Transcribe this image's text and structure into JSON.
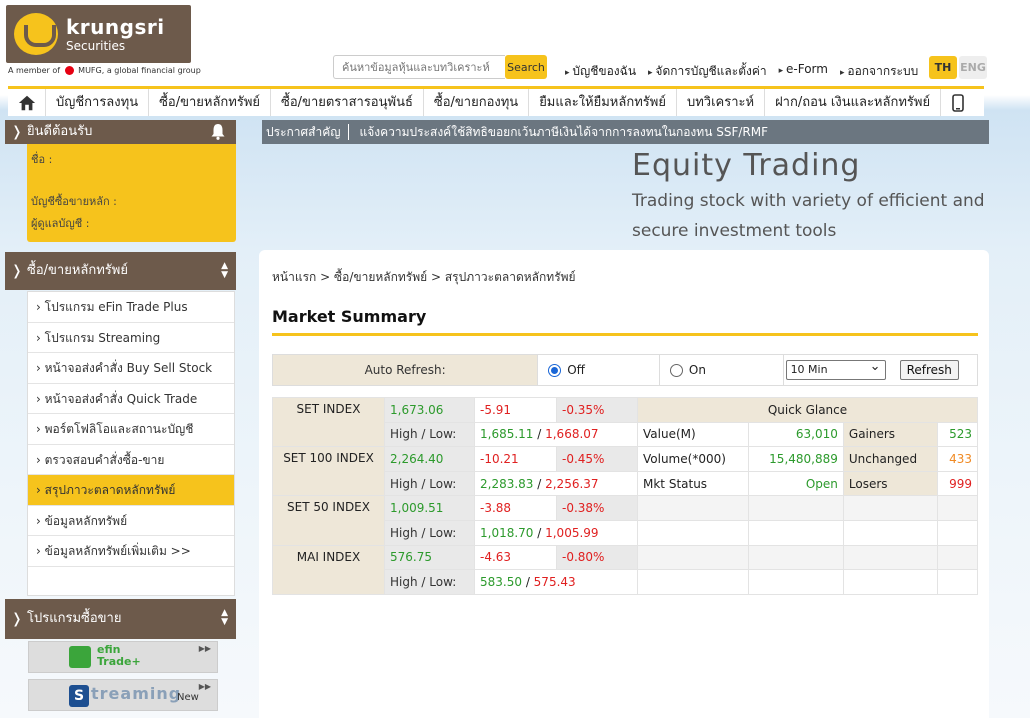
{
  "brand": {
    "name": "krungsri",
    "sub": "Securities",
    "member": "A member of",
    "member_group": "MUFG, a global financial group"
  },
  "search": {
    "placeholder": "ค้นหาข้อมูลหุ้นและบทวิเคราะห์",
    "button": "Search"
  },
  "toplinks": [
    "บัญชีของฉัน",
    "จัดการบัญชีและตั้งค่า",
    "e-Form",
    "ออกจากระบบ"
  ],
  "lang": {
    "th": "TH",
    "en": "ENG"
  },
  "nav": [
    "บัญชีการลงทุน",
    "ซื้อ/ขายหลักทรัพย์",
    "ซื้อ/ขายตราสารอนุพันธ์",
    "ซื้อ/ขายกองทุน",
    "ยืมและให้ยืมหลักทรัพย์",
    "บทวิเคราะห์",
    "ฝาก/ถอน เงินและหลักทรัพย์"
  ],
  "welcome": {
    "title": "ยินดีต้อนรับ",
    "name_label": "ชื่อ :",
    "account_label": "บัญชีซื้อขายหลัก :",
    "manager_label": "ผู้ดูแลบัญชี :"
  },
  "trade_menu": {
    "title": "ซื้อ/ขายหลักทรัพย์",
    "items": [
      "โปรแกรม eFin Trade Plus",
      "โปรแกรม Streaming",
      "หน้าจอส่งคำสั่ง Buy Sell Stock",
      "หน้าจอส่งคำสั่ง Quick Trade",
      "พอร์ตโฟลิโอและสถานะบัญชี",
      "ตรวจสอบคำสั่งซื้อ-ขาย",
      "สรุปภาวะตลาดหลักทรัพย์",
      "ข้อมูลหลักทรัพย์",
      "ข้อมูลหลักทรัพย์เพิ่มเติม >>"
    ],
    "active_index": 6
  },
  "programs": {
    "title": "โปรแกรมซื้อขาย",
    "efin_line1": "efin",
    "efin_line2": "Trade+",
    "streaming": "treaming",
    "streaming_s": "S",
    "streaming_new": "New"
  },
  "announce": {
    "label": "ประกาศสำคัญ",
    "text": "แจ้งความประสงค์ใช้สิทธิขอยกเว้นภาษีเงินได้จากการลงทนในกองทน SSF/RMF"
  },
  "banner": {
    "title": "Equity Trading",
    "subtitle": "Trading stock with variety of efficient and secure investment tools"
  },
  "breadcrumb": "หน้าแรก > ซื้อ/ขายหลักทรัพย์ > สรุปภาวะตลาดหลักทรัพย์",
  "page_title": "Market Summary",
  "refresh": {
    "label": "Auto Refresh:",
    "off": "Off",
    "on": "On",
    "selected": "off",
    "interval": "10 Min",
    "button": "Refresh"
  },
  "indices": [
    {
      "name": "SET INDEX",
      "value": "1,673.06",
      "change": "-5.91",
      "pct": "-0.35%",
      "hl_label": "High / Low:",
      "high": "1,685.11",
      "low": "1,668.07"
    },
    {
      "name": "SET 100 INDEX",
      "value": "2,264.40",
      "change": "-10.21",
      "pct": "-0.45%",
      "hl_label": "High / Low:",
      "high": "2,283.83",
      "low": "2,256.37"
    },
    {
      "name": "SET 50 INDEX",
      "value": "1,009.51",
      "change": "-3.88",
      "pct": "-0.38%",
      "hl_label": "High / Low:",
      "high": "1,018.70",
      "low": "1,005.99"
    },
    {
      "name": "MAI INDEX",
      "value": "576.75",
      "change": "-4.63",
      "pct": "-0.80%",
      "hl_label": "High / Low:",
      "high": "583.50",
      "low": "575.43"
    }
  ],
  "quick_glance": {
    "title": "Quick Glance",
    "value_label": "Value(M)",
    "value": "63,010",
    "volume_label": "Volume(*000)",
    "volume": "15,480,889",
    "status_label": "Mkt Status",
    "status": "Open",
    "gainers_label": "Gainers",
    "gainers": "523",
    "unchanged_label": "Unchanged",
    "unchanged": "433",
    "losers_label": "Losers",
    "losers": "999"
  },
  "colors": {
    "accent": "#f6c31c",
    "brand_brown": "#6d5a4b",
    "up": "#2c9a2c",
    "down": "#e02020",
    "unchanged": "#f08a24"
  }
}
